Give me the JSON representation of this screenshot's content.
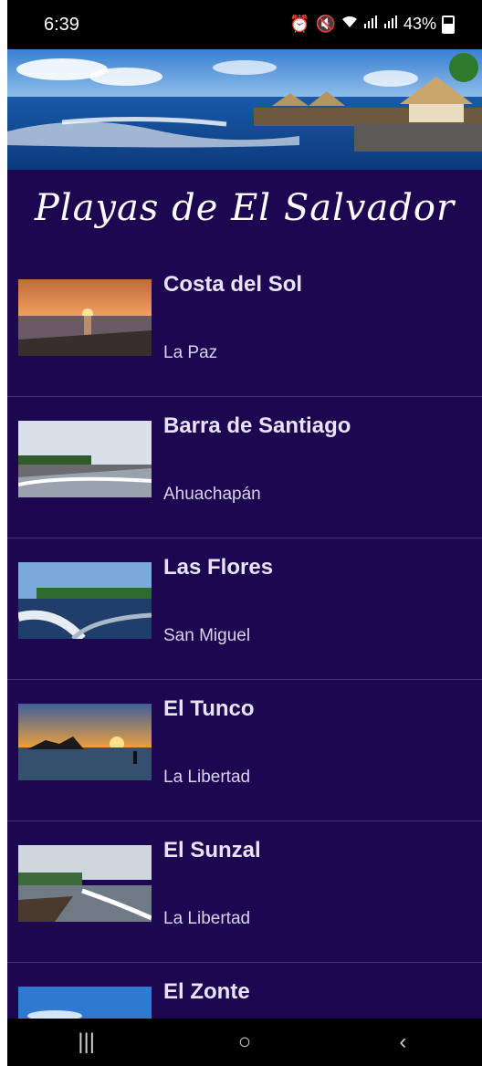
{
  "status_bar": {
    "time": "6:39",
    "battery": "43%",
    "icons": [
      "alarm-icon",
      "mute-icon",
      "wifi-icon",
      "signal-icon",
      "signal-icon",
      "battery-icon"
    ]
  },
  "app": {
    "title": "Playas de El Salvador"
  },
  "beaches": [
    {
      "name": "Costa del Sol",
      "region": "La Paz"
    },
    {
      "name": "Barra de Santiago",
      "region": "Ahuachapán"
    },
    {
      "name": "Las Flores",
      "region": "San Miguel"
    },
    {
      "name": "El Tunco",
      "region": "La Libertad"
    },
    {
      "name": "El Sunzal",
      "region": "La Libertad"
    },
    {
      "name": "El Zonte",
      "region": ""
    }
  ],
  "nav": {
    "recent": "|||",
    "home": "○",
    "back": "‹"
  },
  "colors": {
    "background": "#1c0750",
    "text": "#e9e4f5"
  }
}
